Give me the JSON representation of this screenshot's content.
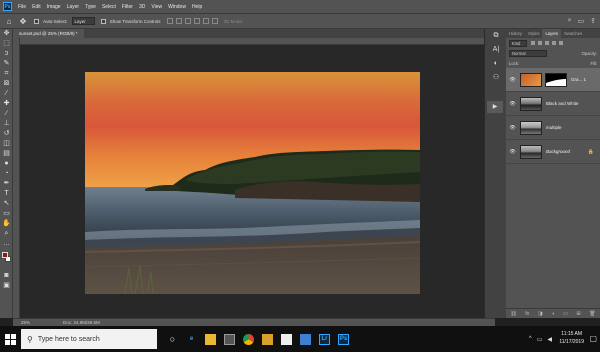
{
  "menubar": {
    "logo": "Ps",
    "items": [
      "File",
      "Edit",
      "Image",
      "Layer",
      "Type",
      "Select",
      "Filter",
      "3D",
      "View",
      "Window",
      "Help"
    ]
  },
  "options": {
    "auto_select_label": "Auto-Select:",
    "auto_select_value": "Layer",
    "transform_label": "Show Transform Controls",
    "mode_3d_label": "3D Mode:"
  },
  "document": {
    "tab_label": "sunset.psd @ 25% (RGB/8) *",
    "zoom": "25%",
    "doc_size": "Doc: 24.9M/49.6M"
  },
  "panel": {
    "tabs": [
      "History",
      "Styles",
      "Layers",
      "Swatches"
    ],
    "active_tab": "Layers",
    "filter_label": "Kind",
    "blend_mode": "Normal",
    "opacity_label": "Opacity:",
    "lock_label": "Lock:",
    "fill_label": "Fill:",
    "layers": [
      {
        "name": "Gra... 1",
        "type": "gradient-map"
      },
      {
        "name": "Black and White",
        "type": "adjustment"
      },
      {
        "name": "multiple",
        "type": "image"
      },
      {
        "name": "Background",
        "type": "image",
        "locked": true
      }
    ]
  },
  "taskbar": {
    "search_placeholder": "Type here to search",
    "time": "11:15 AM",
    "date": "11/17/2019",
    "apps": [
      "task-view",
      "edge",
      "file-explorer",
      "store",
      "chrome",
      "folder",
      "mail",
      "photos",
      "lightroom",
      "photoshop"
    ]
  },
  "colors": {
    "foreground": "#8a1a0a",
    "background": "#ffffff",
    "accent": "#31a8ff"
  }
}
